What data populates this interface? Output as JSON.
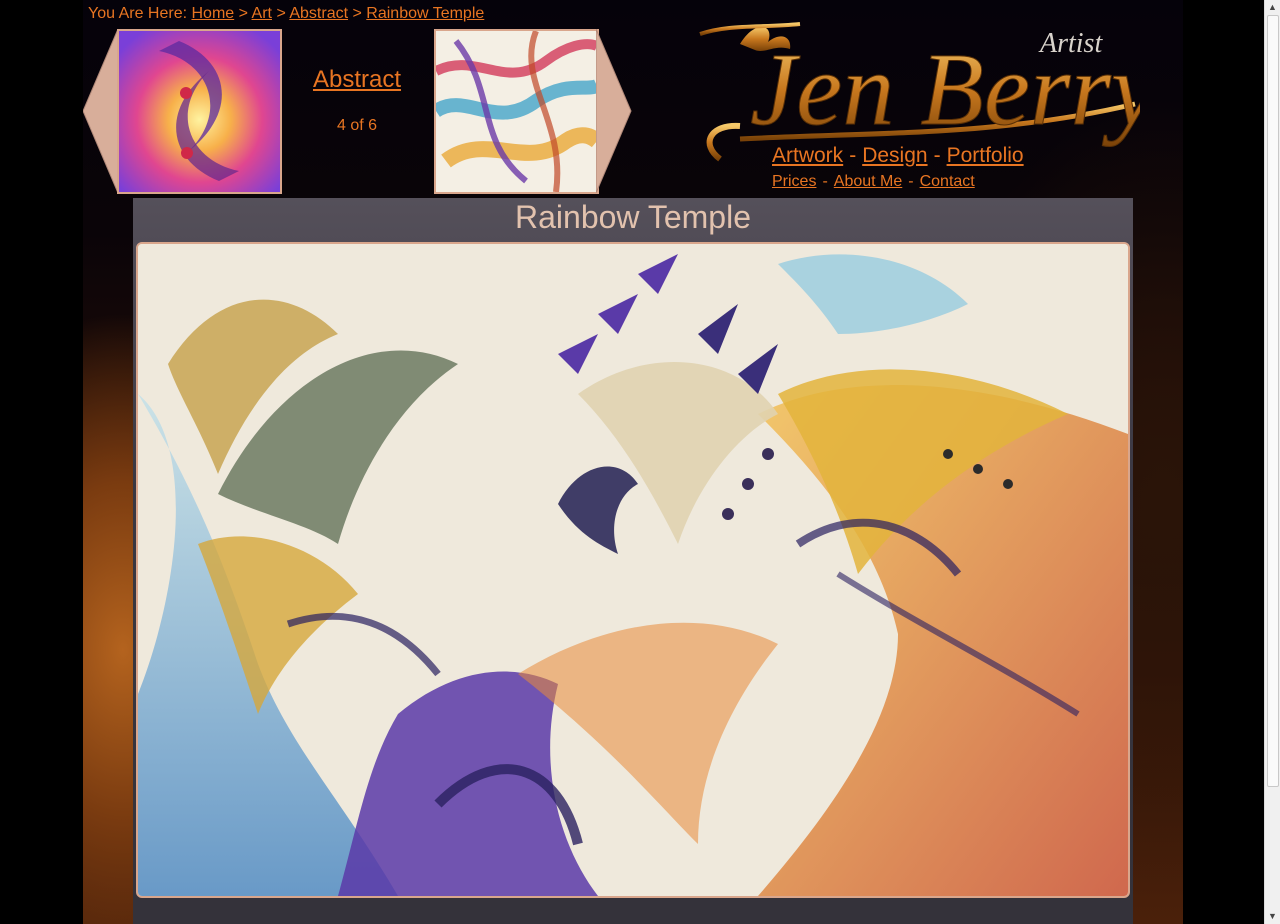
{
  "breadcrumb": {
    "prefix": "You Are Here:",
    "items": [
      "Home",
      "Art",
      "Abstract",
      "Rainbow Temple"
    ],
    "separator": ">"
  },
  "gallery": {
    "title": "Abstract",
    "position": "4 of 6",
    "prev_icon": "left-arrow-icon",
    "next_icon": "right-arrow-icon"
  },
  "logo": {
    "name": "Jen Berry",
    "tagline": "Artist"
  },
  "nav": {
    "primary": [
      "Artwork",
      "Design",
      "Portfolio"
    ],
    "secondary": [
      "Prices",
      "About Me",
      "Contact"
    ],
    "separator": "-"
  },
  "artwork": {
    "title": "Rainbow Temple"
  },
  "colors": {
    "link": "#e87522",
    "border": "#d9a68c",
    "title_text": "#e2c2ae"
  }
}
